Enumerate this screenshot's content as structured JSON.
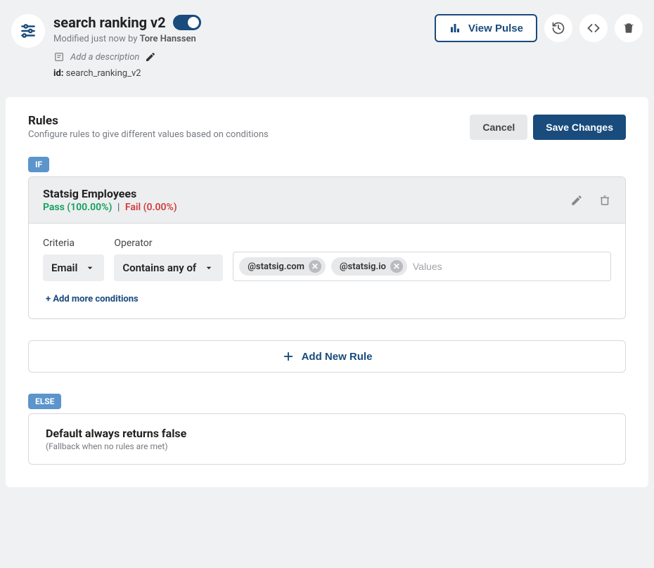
{
  "header": {
    "title": "search ranking v2",
    "modified_prefix": "Modified just now by ",
    "modified_author": "Tore Hanssen",
    "add_description": "Add a description",
    "id_label": "id:",
    "id_value": "search_ranking_v2",
    "view_pulse": "View Pulse",
    "toggle_on": true
  },
  "rules": {
    "heading": "Rules",
    "subheading": "Configure rules to give different values based on conditions",
    "cancel": "Cancel",
    "save": "Save Changes",
    "if_label": "IF",
    "else_label": "ELSE",
    "add_new_rule": "Add New Rule",
    "add_conditions": "+ Add more conditions"
  },
  "rule": {
    "name": "Statsig Employees",
    "pass_label": "Pass (100.00%)",
    "fail_label": "Fail (0.00%)",
    "sep": "|",
    "criteria_label": "Criteria",
    "operator_label": "Operator",
    "criteria_value": "Email",
    "operator_value": "Contains any of",
    "values_placeholder": "Values",
    "chips": [
      "@statsig.com",
      "@statsig.io"
    ]
  },
  "else_rule": {
    "title": "Default always returns false",
    "subtitle": "(Fallback when no rules are met)"
  }
}
